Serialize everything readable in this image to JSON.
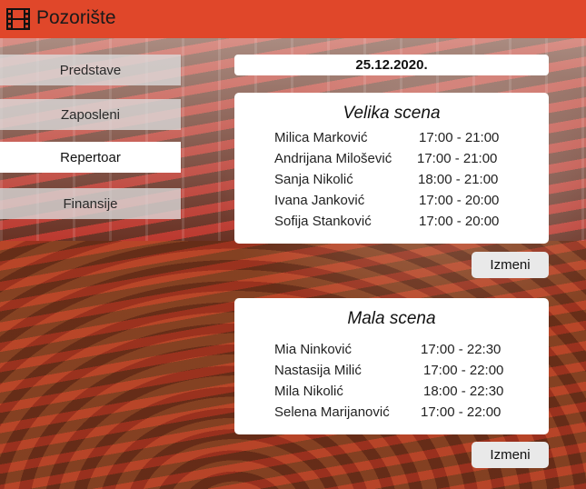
{
  "header": {
    "title": "Pozorište",
    "icon": "film-strip-icon",
    "color": "#e0472a"
  },
  "nav": {
    "items": [
      {
        "label": "Predstave",
        "active": false
      },
      {
        "label": "Zaposleni",
        "active": false
      },
      {
        "label": "Repertoar",
        "active": true
      },
      {
        "label": "Finansije",
        "active": false
      }
    ]
  },
  "main": {
    "date": "25.12.2020.",
    "stages": [
      {
        "title": "Velika scena",
        "button_label": "Izmeni",
        "rows": [
          {
            "name": "Milica Marković",
            "time": "17:00 - 21:00"
          },
          {
            "name": "Andrijana Milošević",
            "time": "17:00 - 21:00"
          },
          {
            "name": "Sanja Nikolić",
            "time": "18:00 - 21:00"
          },
          {
            "name": "Ivana Janković",
            "time": "17:00 - 20:00"
          },
          {
            "name": "Sofija Stanković",
            "time": "17:00 - 20:00"
          }
        ]
      },
      {
        "title": "Mala scena",
        "button_label": "Izmeni",
        "rows": [
          {
            "name": "Mia Ninković",
            "time": "17:00 - 22:30"
          },
          {
            "name": "Nastasija Milić",
            "time": "17:00 - 22:00"
          },
          {
            "name": "Mila Nikolić",
            "time": "18:00 - 22:30"
          },
          {
            "name": "Selena Marijanović",
            "time": "17:00 - 22:00"
          }
        ]
      }
    ]
  }
}
